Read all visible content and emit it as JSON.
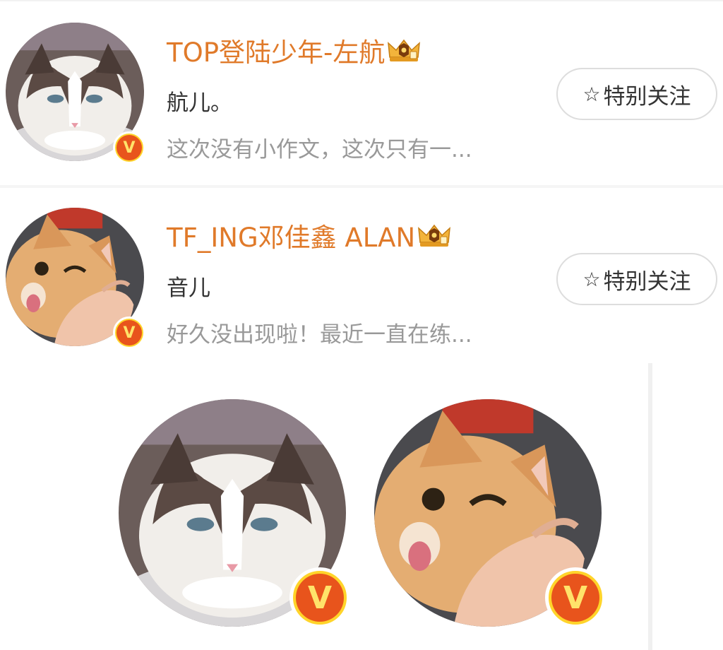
{
  "users": [
    {
      "name": "TOP登陆少年-左航",
      "nickname": "航儿。",
      "bio": "这次没有小作文，这次只有一...",
      "follow_label": "特别关注",
      "avatar_icon": "ragdoll-cat-avatar",
      "verified_badge": "V"
    },
    {
      "name": "TF_ING邓佳鑫 ALAN",
      "nickname": "音儿",
      "bio": "好久没出现啦！最近一直在练...",
      "follow_label": "特别关注",
      "avatar_icon": "orange-cat-avatar",
      "verified_badge": "V"
    }
  ],
  "enlarged_avatars": [
    {
      "avatar_icon": "ragdoll-cat-avatar",
      "verified_badge": "V"
    },
    {
      "avatar_icon": "orange-cat-avatar",
      "verified_badge": "V"
    }
  ],
  "colors": {
    "name": "#e07a2a",
    "nickname": "#333333",
    "bio": "#999999",
    "badge_outer": "#ffd42a",
    "badge_inner": "#e8541c"
  }
}
